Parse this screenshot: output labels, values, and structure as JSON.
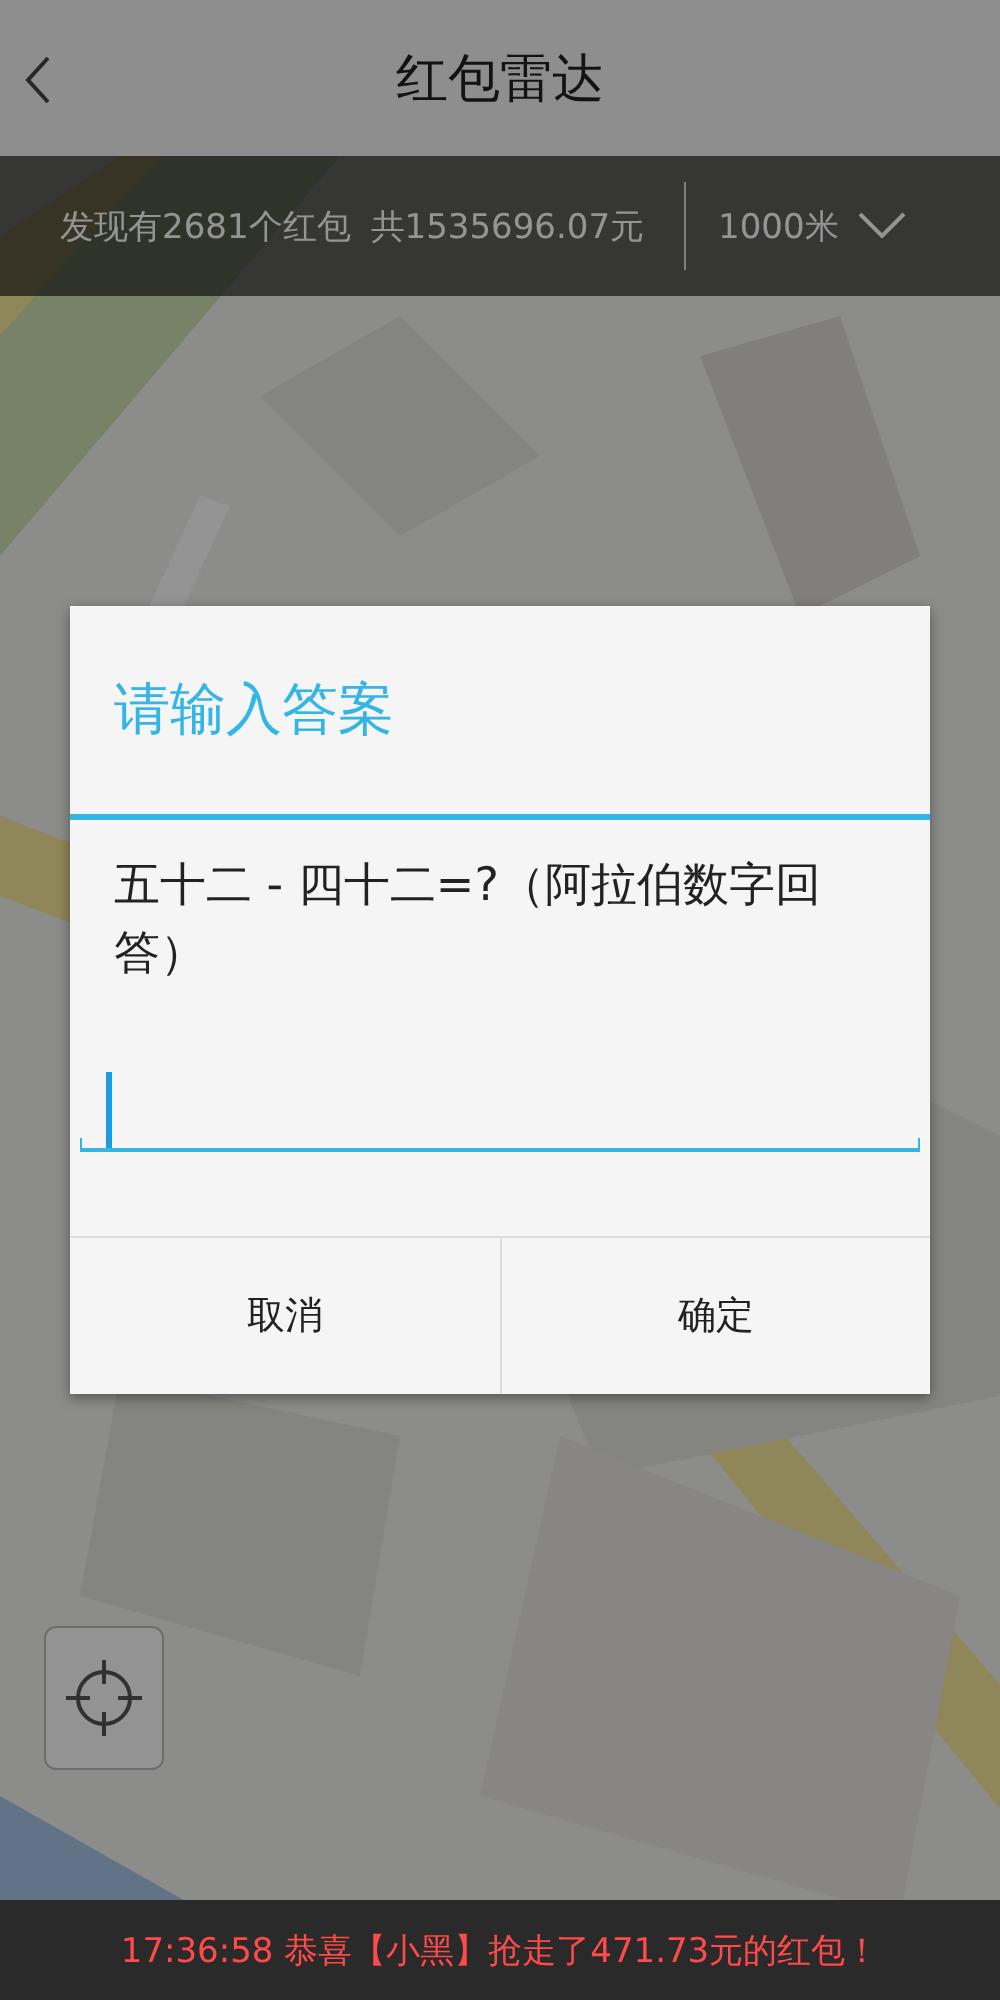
{
  "header": {
    "title": "红包雷达"
  },
  "info_bar": {
    "found": "发现有2681个红包",
    "total": "共1535696.07元",
    "distance": "1000米"
  },
  "ticker": "17:36:58 恭喜【小黑】抢走了471.73元的红包！",
  "dialog": {
    "title": "请输入答案",
    "question": "五十二  -  四十二=?（阿拉伯数字回答）",
    "buttons": [
      "取消",
      "确定"
    ]
  }
}
